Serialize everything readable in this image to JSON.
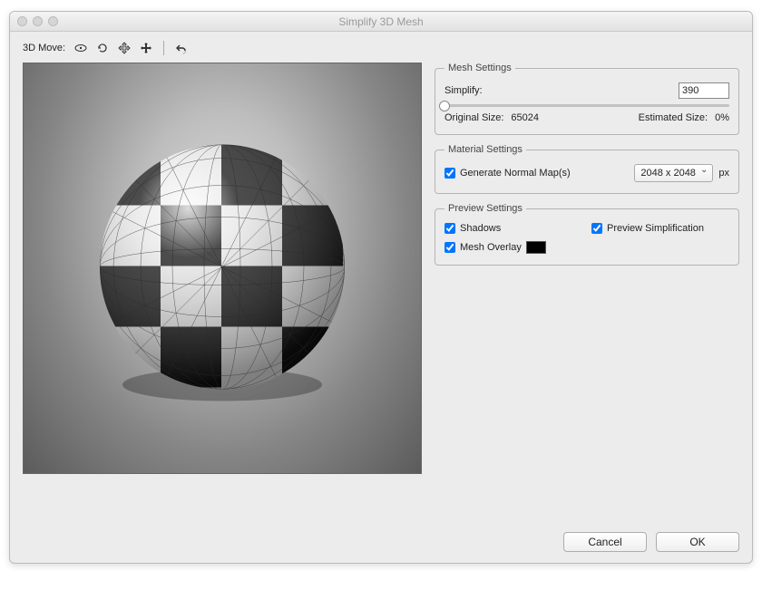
{
  "window": {
    "title": "Simplify 3D Mesh"
  },
  "toolbar": {
    "label": "3D Move:",
    "icons": {
      "orbit": "orbit-icon",
      "rotate": "rotate-icon",
      "pan": "pan-icon",
      "move": "move-icon",
      "undo": "undo-icon"
    }
  },
  "mesh": {
    "legend": "Mesh Settings",
    "simplify_label": "Simplify:",
    "simplify_value": "390",
    "original_size_label": "Original Size:",
    "original_size_value": "65024",
    "estimated_size_label": "Estimated Size:",
    "estimated_size_value": "0%"
  },
  "material": {
    "legend": "Material Settings",
    "generate_normal_label": "Generate Normal Map(s)",
    "generate_normal_checked": true,
    "resolution_selected": "2048 x 2048",
    "px_label": "px"
  },
  "preview_settings": {
    "legend": "Preview Settings",
    "shadows_label": "Shadows",
    "shadows_checked": true,
    "preview_simpl_label": "Preview Simplification",
    "preview_simpl_checked": true,
    "mesh_overlay_label": "Mesh Overlay",
    "mesh_overlay_checked": true,
    "overlay_color": "#000000"
  },
  "buttons": {
    "cancel": "Cancel",
    "ok": "OK"
  }
}
